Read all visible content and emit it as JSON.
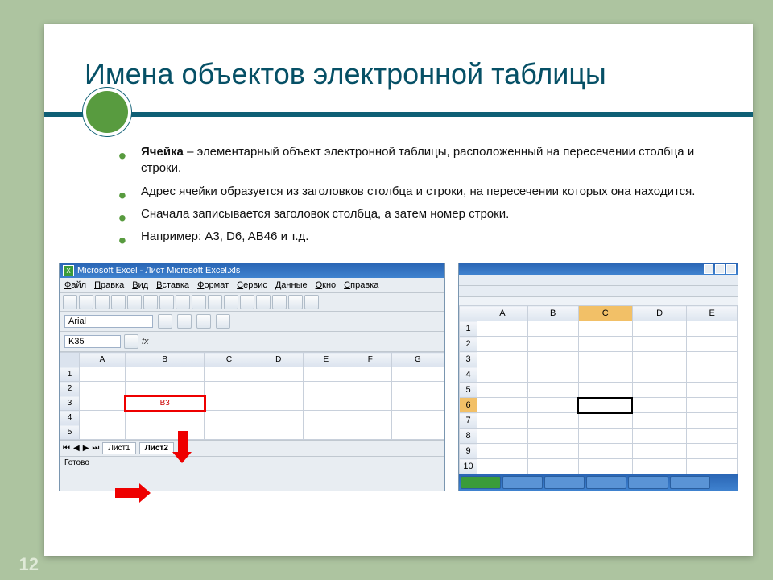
{
  "title": "Имена объектов электронной таблицы",
  "bullets": [
    {
      "lead": "Ячейка",
      "rest": " – элементарный объект электронной таблицы, расположенный на пересечении столбца и строки."
    },
    {
      "lead": "",
      "rest": "Адрес ячейки образуется из заголовков столбца и строки, на пересечении которых она находится."
    },
    {
      "lead": "",
      "rest": "Сначала записывается заголовок столбца, а затем номер строки."
    },
    {
      "lead": "",
      "rest": "Например: A3, D6, AB46 и т.д."
    }
  ],
  "page_number": "12",
  "excel_left": {
    "window_title": "Microsoft Excel - Лист Microsoft Excel.xls",
    "menu": [
      "Файл",
      "Правка",
      "Вид",
      "Вставка",
      "Формат",
      "Сервис",
      "Данные",
      "Окно",
      "Справка"
    ],
    "font_name": "Arial",
    "name_box": "K35",
    "fx_label": "fx",
    "columns": [
      "A",
      "B",
      "C",
      "D",
      "E",
      "F",
      "G"
    ],
    "rows": [
      "1",
      "2",
      "3",
      "4",
      "5"
    ],
    "highlight_cell_text": "B3",
    "sheet_tabs": [
      "Лист1",
      "Лист2"
    ],
    "active_tab_index": 1,
    "status": "Готово"
  },
  "excel_right": {
    "columns": [
      "A",
      "B",
      "C",
      "D",
      "E"
    ],
    "rows": [
      "1",
      "2",
      "3",
      "4",
      "5",
      "6",
      "7",
      "8",
      "9",
      "10"
    ],
    "selected_col": "C",
    "selected_row": "6"
  }
}
